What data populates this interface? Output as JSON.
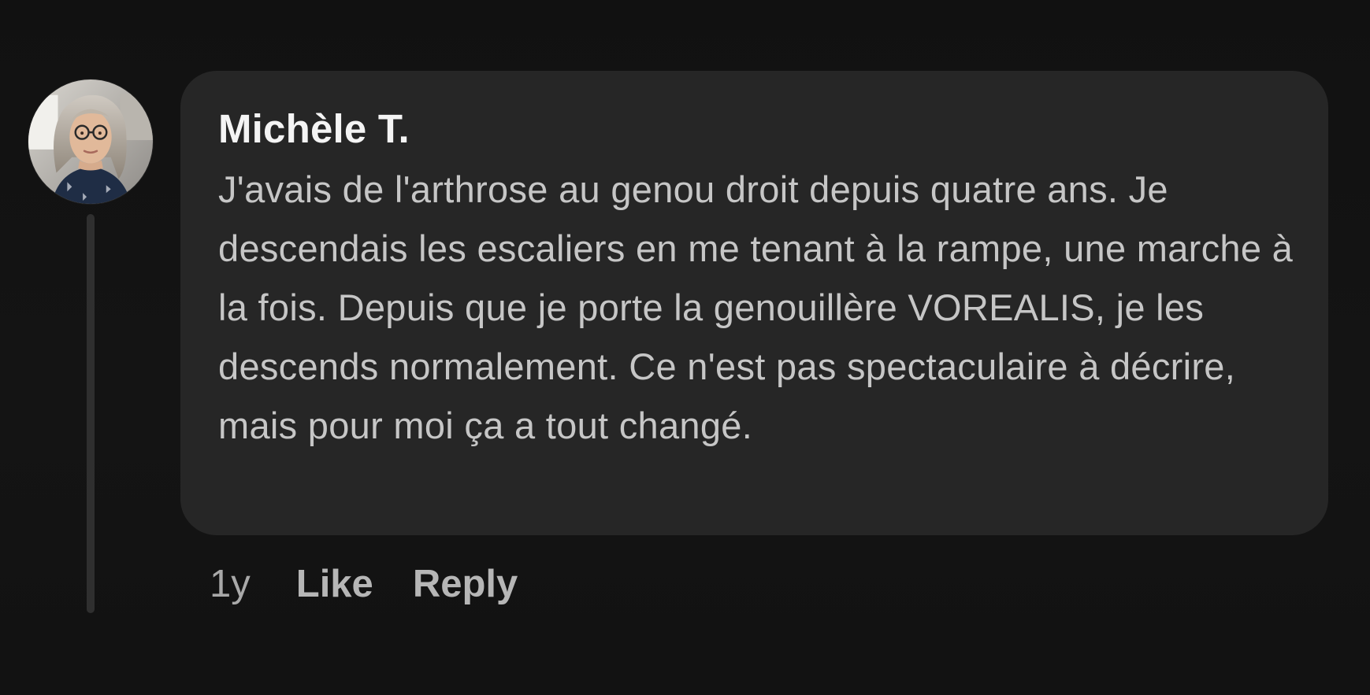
{
  "comment": {
    "author": "Michèle T.",
    "text": "J'avais de l'arthrose au genou droit depuis quatre ans. Je descendais les escaliers en me tenant à la rampe, une marche à la fois. Depuis que je porte la genouillère VOREALIS, je les descends normalement. Ce n'est pas spectaculaire à décrire, mais pour moi ça a tout changé.",
    "timestamp": "1y",
    "like_label": "Like",
    "reply_label": "Reply"
  },
  "colors": {
    "background": "#121212",
    "bubble": "#262626",
    "author_text": "#f4f4f4",
    "body_text": "#c6c6c6",
    "meta_text": "#a9a9a9",
    "thread_line": "#2f2f2f"
  },
  "icons": {
    "avatar": "user-profile-photo"
  }
}
